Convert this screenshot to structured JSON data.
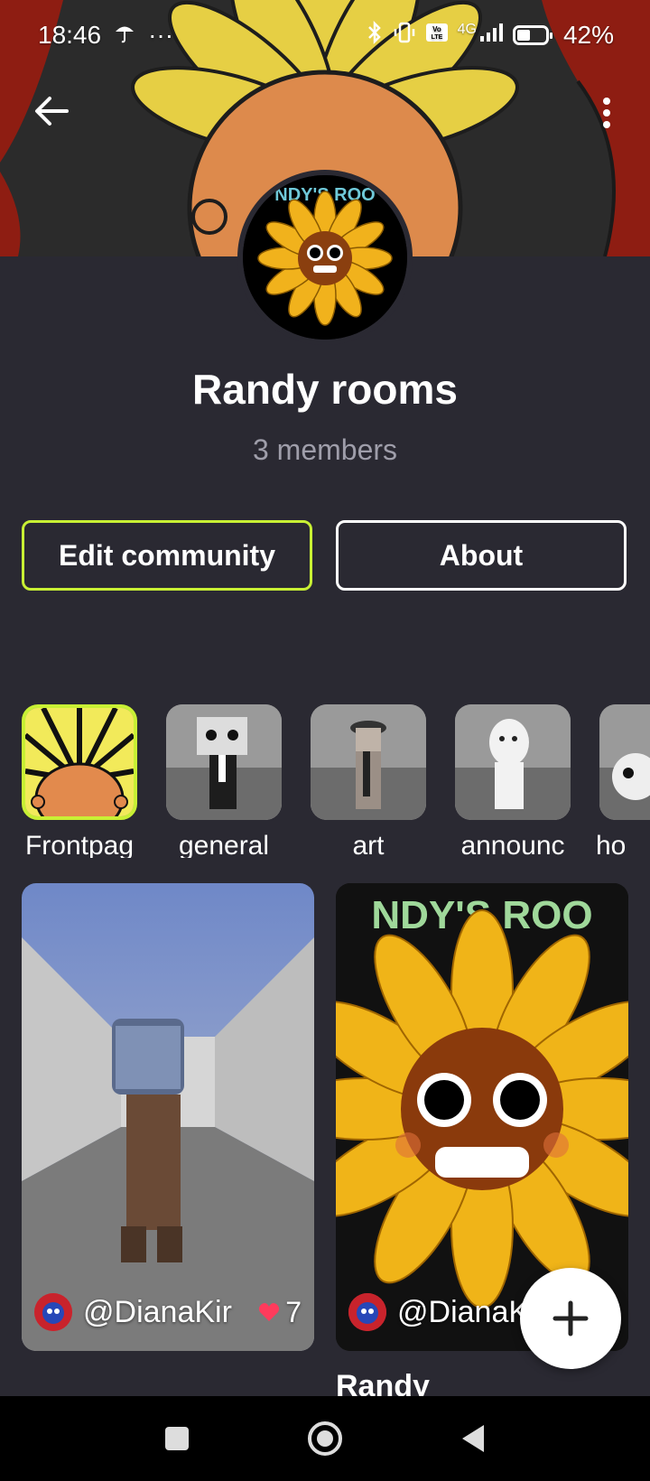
{
  "status_bar": {
    "time": "18:46",
    "overflow": "···",
    "network": "4G",
    "volte": "VoLTE",
    "battery": "42%",
    "icons": [
      "umbrella-icon",
      "bluetooth-icon",
      "vibrate-icon",
      "volte-icon",
      "signal-icon",
      "battery-icon"
    ]
  },
  "header": {
    "back_icon": "arrow-left-icon",
    "more_icon": "more-vertical-icon"
  },
  "community": {
    "name": "Randy rooms",
    "members": "3 members",
    "avatar_text": "NDY'S ROO"
  },
  "actions": {
    "edit_label": "Edit community",
    "about_label": "About"
  },
  "channels": [
    {
      "label": "Frontpag",
      "active": true
    },
    {
      "label": "general",
      "active": false
    },
    {
      "label": "art",
      "active": false
    },
    {
      "label": "announc",
      "active": false
    },
    {
      "label": "ho",
      "active": false
    }
  ],
  "posts": [
    {
      "user": "@DianaKir",
      "likes": "7",
      "caption": "...",
      "image_text": ""
    },
    {
      "user": "@DianaK",
      "likes": "",
      "caption": "Randy",
      "image_text": "NDY'S ROO"
    }
  ],
  "fab_icon": "plus-icon",
  "nav": [
    "recents-square-icon",
    "home-circle-icon",
    "back-triangle-icon"
  ],
  "colors": {
    "background": "#2a2932",
    "accent": "#c8f034",
    "muted": "#9f9eaa",
    "heart": "#ff3b5c"
  }
}
